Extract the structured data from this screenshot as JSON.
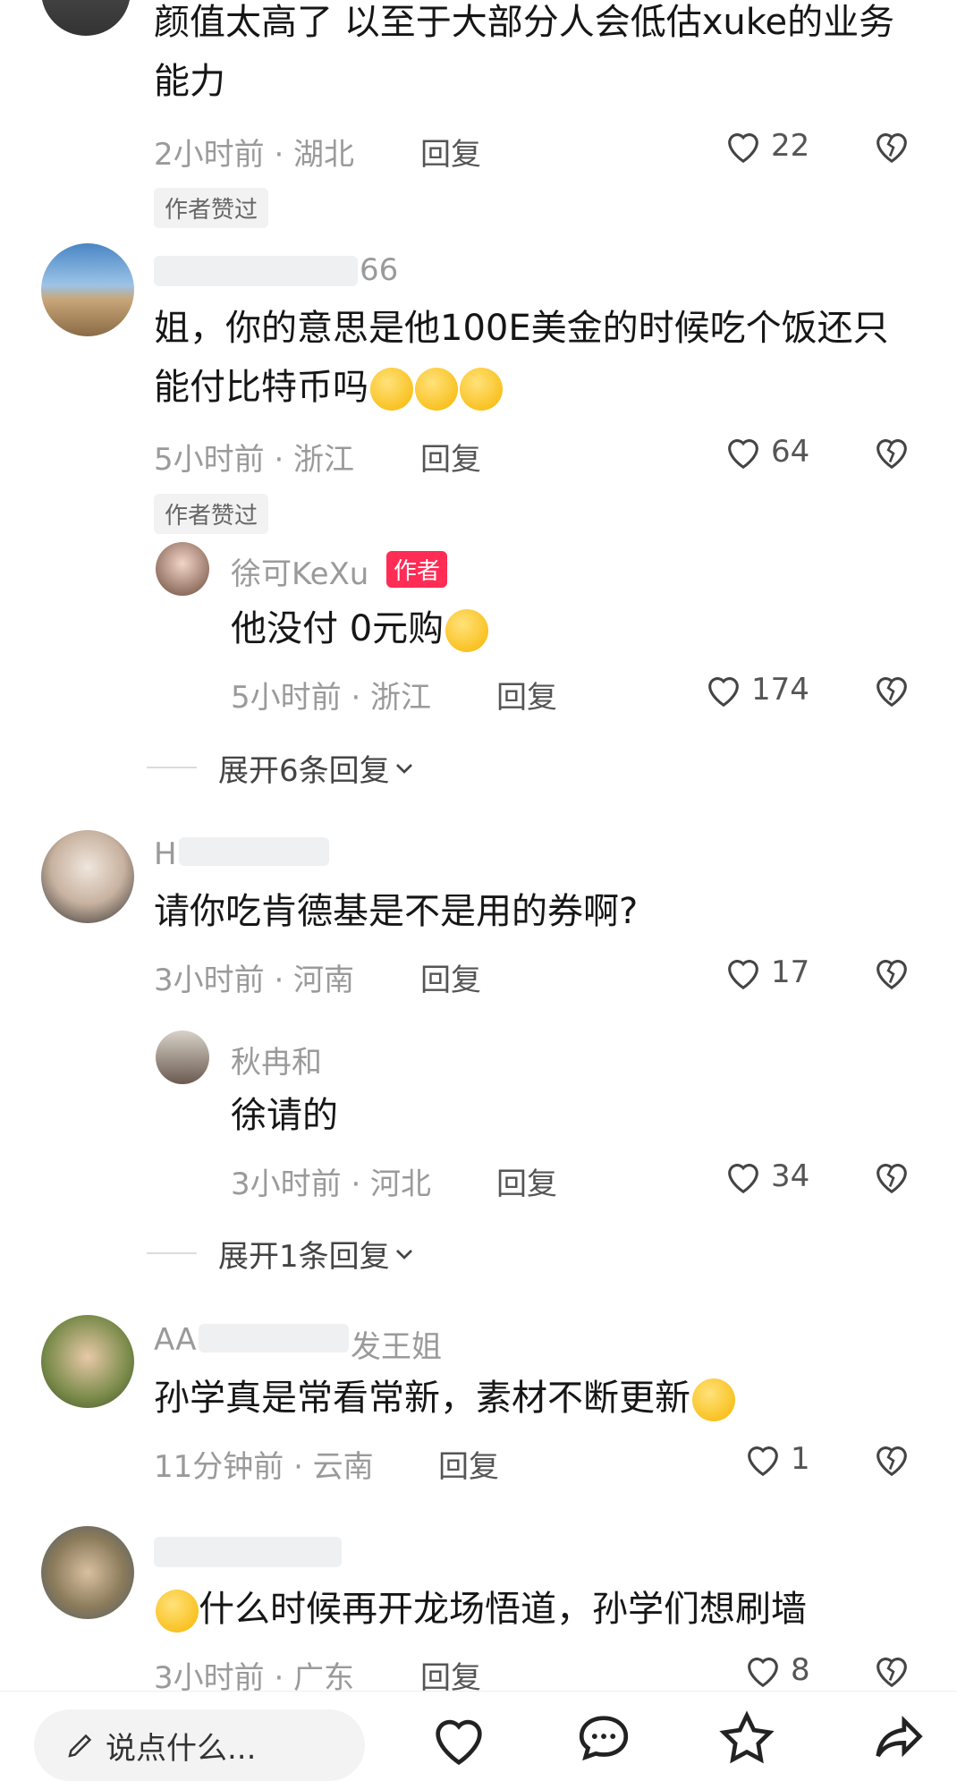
{
  "comments": [
    {
      "text": "颜值太高了 以至于大部分人会低估xuke的业务能力",
      "time_location": "2小时前 · 湖北",
      "reply": "回复",
      "likes": "22",
      "liked_by_author": "作者赞过"
    },
    {
      "username": "66",
      "text": "姐，你的意思是他100E美金的时候吃个饭还只能付比特币吗",
      "time_location": "5小时前 · 浙江",
      "reply": "回复",
      "likes": "64",
      "liked_by_author": "作者赞过",
      "sub_reply": {
        "username": "徐可KeXu",
        "badge": "作者",
        "text": "他没付 0元购",
        "time_location": "5小时前 · 浙江",
        "reply": "回复",
        "likes": "174"
      },
      "expand": "展开6条回复"
    },
    {
      "username": "H",
      "text": "请你吃肯德基是不是用的券啊?",
      "time_location": "3小时前 · 河南",
      "reply": "回复",
      "likes": "17",
      "sub_reply": {
        "username": "秋冉和",
        "text": "徐请的",
        "time_location": "3小时前 · 河北",
        "reply": "回复",
        "likes": "34"
      },
      "expand": "展开1条回复"
    },
    {
      "username_a": "AA",
      "username_b": "发王姐",
      "text": "孙学真是常看常新，素材不断更新",
      "time_location": "11分钟前 · 云南",
      "reply": "回复",
      "likes": "1"
    },
    {
      "text": "什么时候再开龙场悟道，孙学们想刷墙",
      "time_location": "3小时前 · 广东",
      "reply": "回复",
      "likes": "8"
    }
  ],
  "bottom_bar": {
    "input_placeholder": "说点什么...",
    "icons": [
      "heart-icon",
      "comment-icon",
      "star-icon",
      "share-icon"
    ]
  },
  "colors": {
    "accent": "#ff2c55",
    "meta_text": "#9a9a9a"
  }
}
